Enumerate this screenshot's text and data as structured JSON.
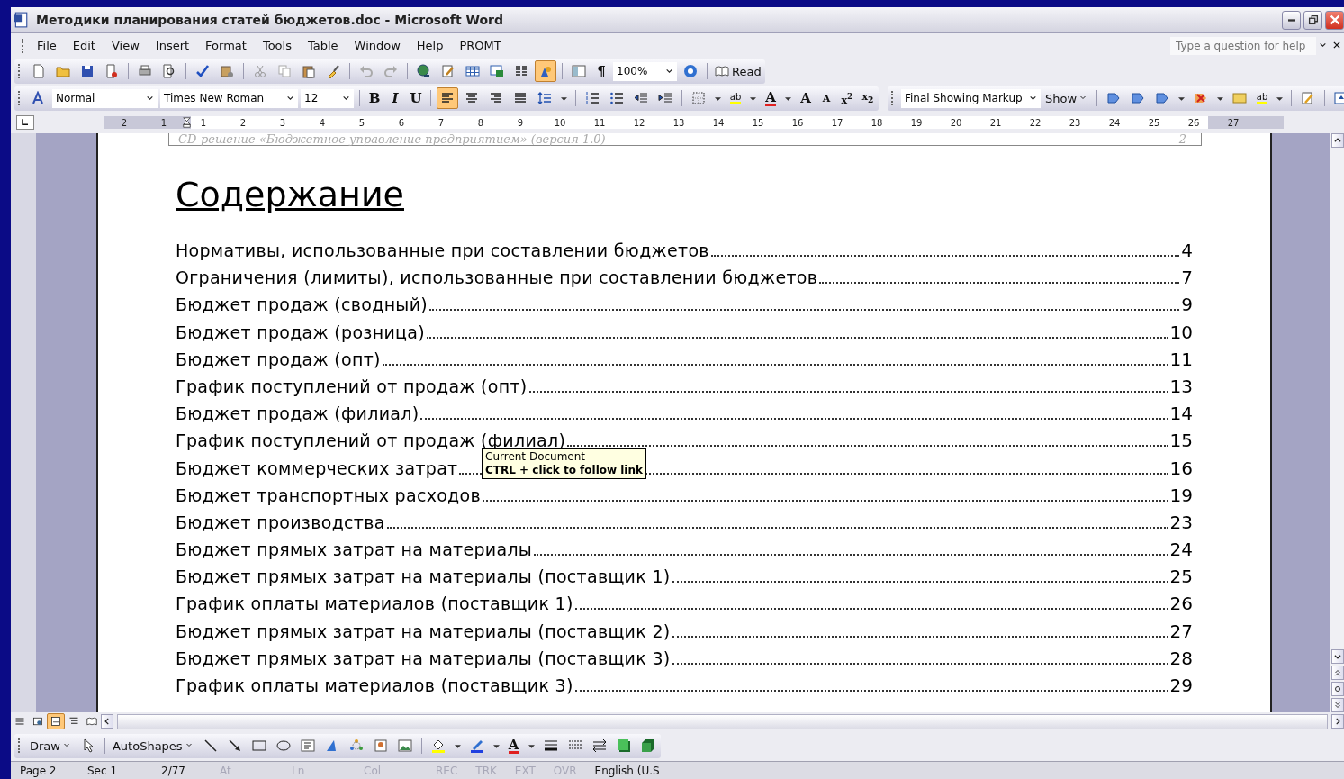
{
  "window": {
    "title": "Методики планирования статей бюджетов.doc - Microsoft Word"
  },
  "menu": [
    "File",
    "Edit",
    "View",
    "Insert",
    "Format",
    "Tools",
    "Table",
    "Window",
    "Help",
    "PROMT"
  ],
  "help_box": {
    "placeholder": "Type a question for help"
  },
  "standard_toolbar": {
    "zoom": "100%",
    "pilcrow": "¶",
    "read": "Read",
    "drawing_on": true
  },
  "formatting_toolbar": {
    "style": "Normal",
    "font": "Times New Roman",
    "size": "12",
    "bold": "B",
    "italic": "I",
    "underline": "U",
    "alignment": [
      {
        "selected": true
      },
      {
        "selected": false
      },
      {
        "selected": false
      },
      {
        "selected": false
      }
    ],
    "highlight": "ab",
    "font_color": "A",
    "grow": "A",
    "shrink": "A",
    "superscript": "x$^{2}$",
    "subscript": "x$_{2}$"
  },
  "reviewing_toolbar": {
    "display": "Final Showing Markup",
    "show": "Show",
    "highlight": "ab"
  },
  "ruler": {
    "labels": [
      "2",
      "1",
      "1",
      "2",
      "3",
      "4",
      "5",
      "6",
      "7",
      "8",
      "9",
      "10",
      "11",
      "12",
      "13",
      "14",
      "15",
      "16",
      "17",
      "18",
      "19",
      "20",
      "21",
      "22",
      "23",
      "24",
      "25",
      "26",
      "27"
    ]
  },
  "document": {
    "header": {
      "text": "CD-решение «Бюджетное управление предприятием» (версия 1.0)",
      "page": "2"
    },
    "heading": "Содержание",
    "toc": [
      {
        "title": "Нормативы, использованные при составлении бюджетов",
        "page": "4"
      },
      {
        "title": "Ограничения (лимиты), использованные при составлении бюджетов",
        "page": "7"
      },
      {
        "title": "Бюджет продаж (сводный)",
        "page": "9"
      },
      {
        "title": "Бюджет продаж (розница)",
        "page": "10"
      },
      {
        "title": "Бюджет продаж (опт)",
        "page": "11"
      },
      {
        "title": "График поступлений от продаж (опт)",
        "page": "13"
      },
      {
        "title": "Бюджет продаж (филиал)",
        "page": "14"
      },
      {
        "title": "График поступлений от продаж (филиал)",
        "page": "15"
      },
      {
        "title": "Бюджет коммерческих затрат",
        "page": "16"
      },
      {
        "title": "Бюджет транспортных расходов",
        "page": "19"
      },
      {
        "title": "Бюджет производства",
        "page": "23"
      },
      {
        "title": "Бюджет прямых затрат на материалы",
        "page": "24"
      },
      {
        "title": "Бюджет прямых затрат на материалы (поставщик 1)",
        "page": "25"
      },
      {
        "title": "График оплаты материалов (поставщик 1)",
        "page": "26"
      },
      {
        "title": "Бюджет прямых затрат на материалы (поставщик 2)",
        "page": "27"
      },
      {
        "title": "Бюджет прямых затрат на материалы (поставщик 3)",
        "page": "28"
      },
      {
        "title": "График оплаты материалов (поставщик 3)",
        "page": "29"
      }
    ]
  },
  "tooltip": {
    "lines": [
      "Current Document",
      "CTRL + click to follow link"
    ]
  },
  "view_buttons": [
    {
      "selected": false
    },
    {
      "selected": false
    },
    {
      "selected": true
    },
    {
      "selected": false
    },
    {
      "selected": false
    }
  ],
  "drawing_toolbar": {
    "draw": "Draw",
    "autoshapes": "AutoShapes",
    "font_color": "A"
  },
  "status_bar": [
    {
      "text": "Page 2",
      "disabled": false
    },
    {
      "text": "Sec 1",
      "disabled": false
    },
    {
      "text": "2/77",
      "disabled": false
    },
    {
      "text": "At",
      "disabled": true
    },
    {
      "text": "Ln",
      "disabled": true
    },
    {
      "text": "Col",
      "disabled": true
    },
    {
      "text": "REC",
      "disabled": true
    },
    {
      "text": "TRK",
      "disabled": true
    },
    {
      "text": "EXT",
      "disabled": true
    },
    {
      "text": "OVR",
      "disabled": true
    },
    {
      "text": "English (U.S",
      "disabled": false
    }
  ]
}
